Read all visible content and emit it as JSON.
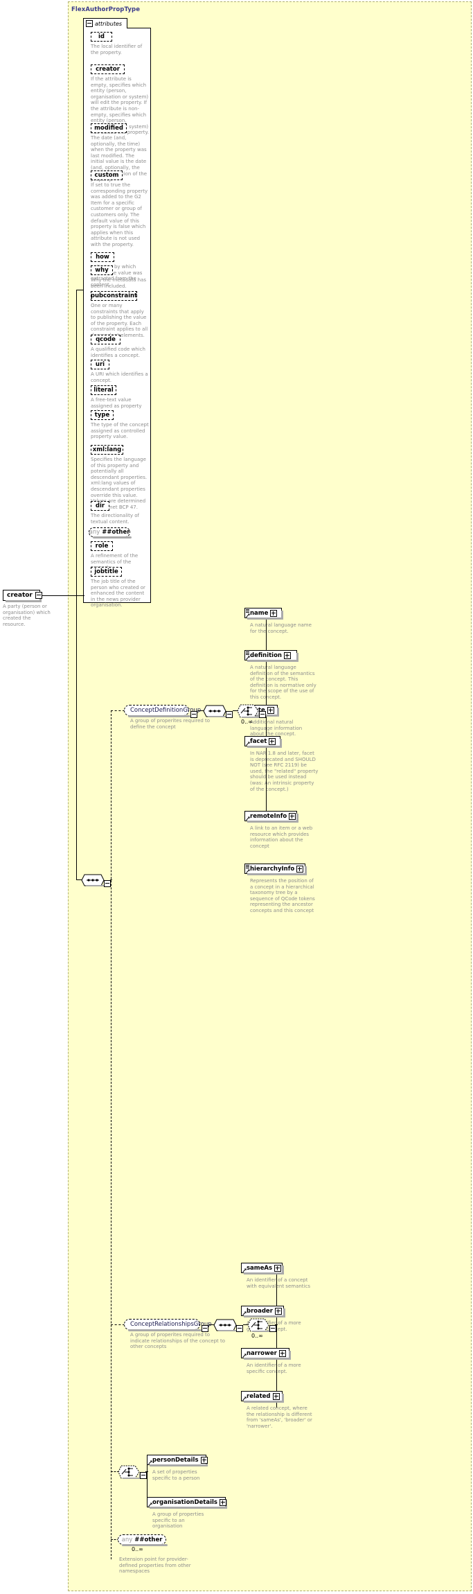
{
  "diagram": {
    "type_name": "FlexAuthorPropType",
    "attributes_label": "attributes"
  },
  "root_element": {
    "label": "creator",
    "doc": "A party (person or organisation) which created the resource."
  },
  "attributes": [
    {
      "name": "id",
      "doc": "The local identifier of the property."
    },
    {
      "name": "creator",
      "doc": "If the attribute is empty, specifies which entity (person, organisation or system) will edit the property. If the attribute is non-empty, specifies which entity (person, organisation or system) has edited the property."
    },
    {
      "name": "modified",
      "doc": "The date (and, optionally, the time) when the property was last modified. The initial value is the date (and, optionally, the time) of creation of the property."
    },
    {
      "name": "custom",
      "doc": "If set to true the corresponding property was added to the G2 Item for a specific customer or group of customers only. The default value of this property is false which applies when this attribute is not used with the property."
    },
    {
      "name": "how",
      "doc": "Indicates by which means the value was extracted from the content."
    },
    {
      "name": "why",
      "doc": "Why the metadata has been included."
    },
    {
      "name": "pubconstraint",
      "doc": "One or many constraints that apply to publishing the value of the property. Each constraint applies to all descendant elements."
    },
    {
      "name": "qcode",
      "doc": "A qualified code which identifies a concept."
    },
    {
      "name": "uri",
      "doc": "A URI which identifies a concept."
    },
    {
      "name": "literal",
      "doc": "A free-text value assigned as property value."
    },
    {
      "name": "type",
      "doc": "The type of the concept assigned as controlled property value."
    },
    {
      "name": "xml:lang",
      "doc": "Specifies the language of this property and potentially all descendant properties. xml:lang values of descendant properties override this value. Values are determined by Internet BCP 47."
    },
    {
      "name": "dir",
      "doc": "The directionality of textual content."
    },
    {
      "name": "any ##other",
      "doc": "",
      "is_any": true
    },
    {
      "name": "role",
      "doc": "A refinement of the semantics of the property."
    },
    {
      "name": "jobtitle",
      "doc": "The job title of the person who created or enhanced the content in the news provider organisation."
    }
  ],
  "concept_definition_group": {
    "label": "ConceptDefinitionGroup",
    "doc": "A group of properites required to define the concept",
    "occurs": "0..∞",
    "children": [
      {
        "name": "name",
        "doc": "A natural language name for the concept."
      },
      {
        "name": "definition",
        "doc": "A natural language definition of the semantics of the concept. This definition is normative only for the scope of the use of this concept."
      },
      {
        "name": "note",
        "doc": "Additional natural language information about the concept."
      },
      {
        "name": "facet",
        "doc": "In NAR 1.8 and later, facet is deprecated and SHOULD NOT (see RFC 2119) be used, the \"related\" property should be used instead (was: An intrinsic property of the concept.)"
      },
      {
        "name": "remoteInfo",
        "doc": "A link to an item or a web resource which provides information about the concept"
      },
      {
        "name": "hierarchyInfo",
        "doc": "Represents the position of a concept in a hierarchical taxonomy tree by a sequence of QCode tokens representing the ancestor concepts and this concept"
      }
    ]
  },
  "concept_relationships_group": {
    "label": "ConceptRelationshipsGroup",
    "doc": "A group of properites required to indicate relationships of the concept to other concepts",
    "occurs": "0..∞",
    "children": [
      {
        "name": "sameAs",
        "doc": "An identifier of a concept with equivalent semantics"
      },
      {
        "name": "broader",
        "doc": "An identifier of a more generic concept."
      },
      {
        "name": "narrower",
        "doc": "An identifier of a more specific concept."
      },
      {
        "name": "related",
        "doc": "A related concept, where the relationship is different from 'sameAs', 'broader' or 'narrower'."
      }
    ]
  },
  "details_choice": {
    "children": [
      {
        "name": "personDetails",
        "doc": "A set of properties specific to a person"
      },
      {
        "name": "organisationDetails",
        "doc": "A group of properties specific to an organisation"
      }
    ]
  },
  "any_other": {
    "any_label": "any",
    "namespace_label": "##other",
    "occurs": "0..∞",
    "doc": "Extension point for provider-defined properties from other namespaces"
  },
  "colors": {
    "type_background": "#ffffcc",
    "type_border": "#b0b070",
    "title_color": "#3a3a8c",
    "doc_text": "#8d8d8d",
    "shadow": "#aaaaaa"
  }
}
